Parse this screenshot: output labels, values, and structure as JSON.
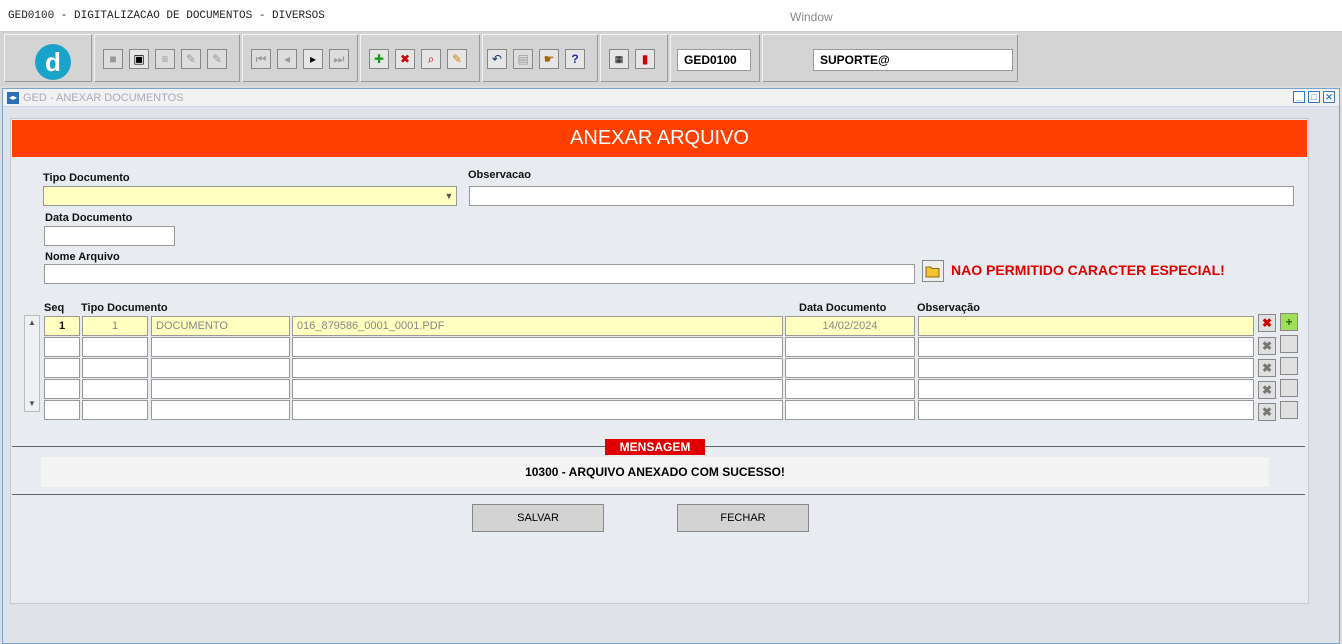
{
  "titlebar": {
    "app_title": "GED0100 - DIGITALIZACAO DE DOCUMENTOS - DIVERSOS",
    "menu": "Window"
  },
  "toolbar": {
    "module": "GED0100",
    "user": "SUPORTE@",
    "logo": "d",
    "help": "?"
  },
  "window": {
    "title": "GED - ANEXAR DOCUMENTOS"
  },
  "form": {
    "banner": "ANEXAR ARQUIVO",
    "tipo_label": "Tipo Documento",
    "tipo_value": "",
    "observacao_label": "Observacao",
    "observacao_value": "",
    "data_label": "Data Documento",
    "data_value": "",
    "nome_label": "Nome Arquivo",
    "nome_value": "",
    "warning": "NAO PERMITIDO CARACTER ESPECIAL!"
  },
  "grid": {
    "headers": {
      "seq": "Seq",
      "tipo": "Tipo Documento",
      "data": "Data Documento",
      "obs": "Observação"
    },
    "rows": [
      {
        "seq": "1",
        "tipo_cod": "1",
        "tipo_desc": "DOCUMENTO",
        "arquivo": "016_879586_0001_0001.PDF",
        "data": "14/02/2024",
        "obs": ""
      },
      {
        "seq": "",
        "tipo_cod": "",
        "tipo_desc": "",
        "arquivo": "",
        "data": "",
        "obs": ""
      },
      {
        "seq": "",
        "tipo_cod": "",
        "tipo_desc": "",
        "arquivo": "",
        "data": "",
        "obs": ""
      },
      {
        "seq": "",
        "tipo_cod": "",
        "tipo_desc": "",
        "arquivo": "",
        "data": "",
        "obs": ""
      },
      {
        "seq": "",
        "tipo_cod": "",
        "tipo_desc": "",
        "arquivo": "",
        "data": "",
        "obs": ""
      }
    ]
  },
  "message": {
    "title": "MENSAGEM",
    "text": "10300 - ARQUIVO ANEXADO COM SUCESSO!"
  },
  "buttons": {
    "save": "SALVAR",
    "close": "FECHAR"
  },
  "colors": {
    "banner": "#ff4000",
    "warning": "#e00000",
    "field_highlight": "#ffffc0"
  }
}
